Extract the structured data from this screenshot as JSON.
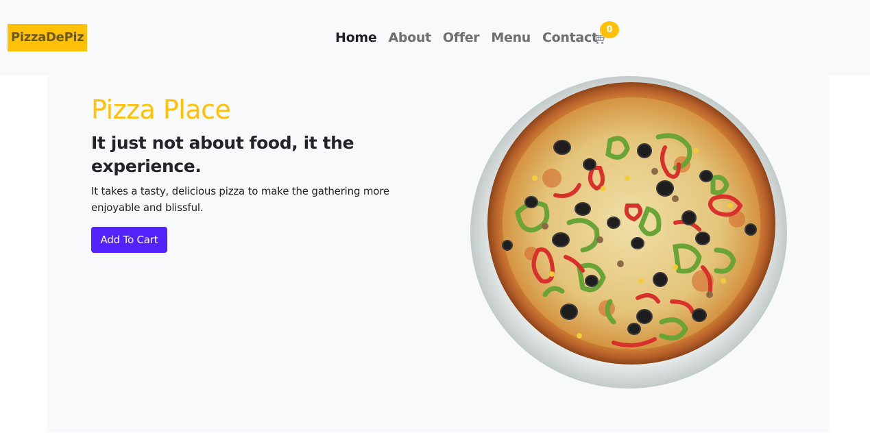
{
  "nav": {
    "brand": "PizzaDePiz",
    "links": [
      "Home",
      "About",
      "Offer",
      "Menu",
      "Contact"
    ],
    "cart_count": "0",
    "cart_icon": "cart-icon"
  },
  "hero": {
    "title": "Pizza Place",
    "subtitle": "It just not about food, it the experience.",
    "text": "It takes a tasty, delicious pizza to make the gathering more enjoyable and blissful.",
    "button_label": "Add To Cart",
    "image": "pizza-image"
  },
  "colors": {
    "accent": "#ffc107",
    "button": "#5322fd",
    "nav_bg": "#f8f9fa"
  }
}
